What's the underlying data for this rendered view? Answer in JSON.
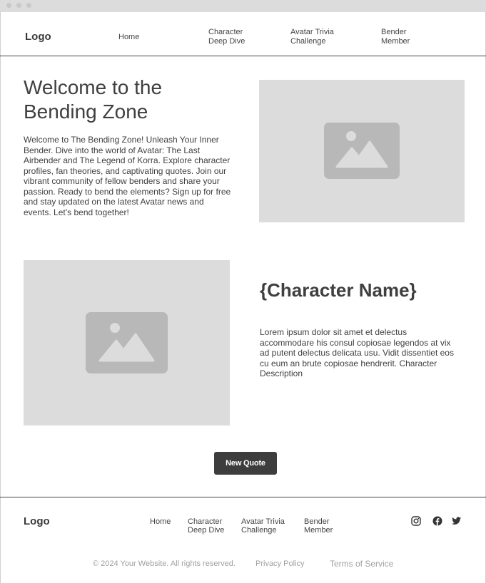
{
  "header": {
    "logo": "Logo",
    "nav": [
      {
        "line1": "Home",
        "line2": ""
      },
      {
        "line1": "Character",
        "line2": "Deep Dive"
      },
      {
        "line1": "Avatar Trivia",
        "line2": "Challenge"
      },
      {
        "line1": "Bender",
        "line2": "Member"
      }
    ]
  },
  "hero": {
    "title": "Welcome to the Bending Zone",
    "text": "Welcome to The Bending Zone! Unleash Your Inner Bender. Dive into the world of Avatar: The Last Airbender and The Legend of Korra. Explore character profiles, fan theories, and captivating quotes. Join our vibrant community of fellow benders and share your passion. Ready to bend the elements? Sign up for free and stay updated on the latest Avatar news and events. Let’s bend together!"
  },
  "character": {
    "name": "{Character Name}",
    "description": "Lorem ipsum dolor sit amet et delectus accommodare his consul copiosae legendos at vix ad putent delectus delicata usu. Vidit dissentiet eos cu eum an brute copiosae hendrerit. Character Description"
  },
  "quote_button": "New Quote",
  "footer": {
    "logo": "Logo",
    "nav": [
      {
        "line1": "Home",
        "line2": ""
      },
      {
        "line1": "Character",
        "line2": "Deep Dive"
      },
      {
        "line1": "Avatar Trivia",
        "line2": "Challenge"
      },
      {
        "line1": "Bender",
        "line2": "Member"
      }
    ],
    "social": [
      "instagram-icon",
      "facebook-icon",
      "twitter-icon"
    ],
    "copyright": "© 2024 Your Website. All rights reserved.",
    "privacy": "Privacy Policy",
    "terms": "Terms of Service"
  }
}
